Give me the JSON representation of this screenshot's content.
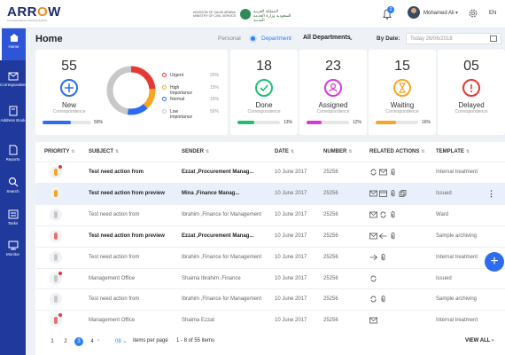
{
  "header": {
    "logo_text_a": "ARR",
    "logo_text_o": "O",
    "logo_text_b": "W",
    "logo_sub": "Correspondence Tracking System",
    "ministry_en": "KINGDOM OF SAUDI ARABIA MINISTRY OF CIVIL SERVICE",
    "ministry_ar": "المملكة العربية السعودية وزارة الخدمة المدنية",
    "notif_count": "2",
    "user_name": "Mohamed Ali",
    "lang": "EN"
  },
  "sidebar": {
    "items": [
      {
        "label": "Home",
        "icon": "home-icon"
      },
      {
        "label": "Correspondence",
        "icon": "mail-icon"
      },
      {
        "label": "Address Book",
        "icon": "book-icon"
      },
      {
        "label": "Reports",
        "icon": "reports-icon"
      },
      {
        "label": "Search",
        "icon": "search-icon"
      },
      {
        "label": "Tasks",
        "icon": "tasks-icon"
      },
      {
        "label": "Monitor",
        "icon": "monitor-icon"
      }
    ]
  },
  "page": {
    "title": "Home",
    "toggle_personal": "Personal",
    "toggle_department": "Department",
    "department_select": "All Departments",
    "bydate_label": "By Date:",
    "date_value": "Today 26/06/2018"
  },
  "cards": {
    "new": {
      "count": "55",
      "title": "New",
      "sub": "Correspondence",
      "pct_label": "59%",
      "pct": 59,
      "color": "#2d6cf0"
    },
    "legend": [
      {
        "label": "Urgent",
        "pct": "25%",
        "color": "#e53935"
      },
      {
        "label": "High Importance",
        "pct": "15%",
        "color": "#f5a623"
      },
      {
        "label": "Normal",
        "pct": "15%",
        "color": "#2d6cf0"
      },
      {
        "label": "Low Importance",
        "pct": "50%",
        "color": "#c8c8c8"
      }
    ],
    "small": [
      {
        "count": "18",
        "title": "Done",
        "sub": "Correspondence",
        "pct_label": "13%",
        "pct": 13,
        "color": "#1dbf73"
      },
      {
        "count": "23",
        "title": "Assigned",
        "sub": "Correspondence",
        "pct_label": "12%",
        "pct": 12,
        "color": "#d63ad6"
      },
      {
        "count": "15",
        "title": "Waiting",
        "sub": "Correspondence",
        "pct_label": "16%",
        "pct": 16,
        "color": "#f5a623"
      },
      {
        "count": "05",
        "title": "Delayed",
        "sub": "Correspondence",
        "pct_label": "",
        "pct": 0,
        "color": "#e53935"
      }
    ]
  },
  "table": {
    "headers": [
      "PRIORITY",
      "SUBJECT",
      "SENDER",
      "DATE",
      "NUMBER",
      "RELATED ACTIONS",
      "TEMPLATE"
    ],
    "rows": [
      {
        "subject": "Test need action from",
        "sender": "Ezzat ,Procurement Manag...",
        "date": "10 June 2017",
        "number": "25256",
        "template": "Internal treatment",
        "bold": true,
        "priority_color": "#f5a623",
        "unread": true
      },
      {
        "subject": "Test need action from preview",
        "sender": "Mina ,Finance Manag...",
        "date": "10 June 2017",
        "number": "25256",
        "template": "Issued",
        "bold": true,
        "priority_color": "#f5a623",
        "unread": false
      },
      {
        "subject": "Test need action from",
        "sender": "Ibrahim ,Finance for Management",
        "date": "10 June 2017",
        "number": "25256",
        "template": "Ward",
        "bold": false,
        "priority_color": "#c8c8c8",
        "unread": false
      },
      {
        "subject": "Test need action from preview",
        "sender": "Ezzat ,Procurement Manag...",
        "date": "10 June 2017",
        "number": "25256",
        "template": "Sample archiving",
        "bold": true,
        "priority_color": "#e57373",
        "unread": false
      },
      {
        "subject": "Test need action from",
        "sender": "Ibrahim ,Finance for Management",
        "date": "10 June 2017",
        "number": "25256",
        "template": "Internal treatment",
        "bold": false,
        "priority_color": "#c8c8c8",
        "unread": false
      },
      {
        "subject": "Management Office",
        "sender": "Shaima Ibrahim ,Finance",
        "date": "10 June 2017",
        "number": "25256",
        "template": "Issued",
        "bold": false,
        "priority_color": "#c8c8c8",
        "unread": true
      },
      {
        "subject": "Test need action from",
        "sender": "Ibrahim ,Finance for Management",
        "date": "10 June 2017",
        "number": "25256",
        "template": "Sample archiving",
        "bold": false,
        "priority_color": "#c8c8c8",
        "unread": false
      },
      {
        "subject": "Management Office",
        "sender": "Shaima Ezzat",
        "date": "10 June 2017",
        "number": "25256",
        "template": "Internal treatment",
        "bold": false,
        "priority_color": "#e57373",
        "unread": true
      }
    ]
  },
  "pagination": {
    "pages": [
      "1",
      "2",
      "3",
      "4"
    ],
    "current": "3",
    "per_page": "08",
    "per_page_label": "items per page",
    "range": "1 - 8 of 55 items",
    "view_all": "VIEW ALL"
  }
}
